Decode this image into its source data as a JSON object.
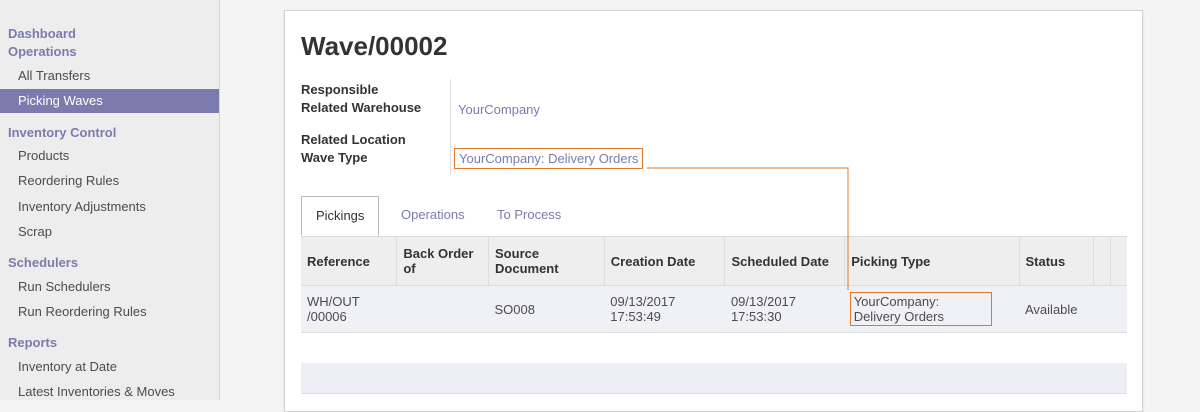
{
  "sidebar": {
    "sections": [
      {
        "title": "Dashboard",
        "items": []
      },
      {
        "title": "Operations",
        "items": [
          "All Transfers",
          "Picking Waves"
        ]
      },
      {
        "title": "Inventory Control",
        "items": [
          "Products",
          "Reordering Rules",
          "Inventory Adjustments",
          "Scrap"
        ]
      },
      {
        "title": "Schedulers",
        "items": [
          "Run Schedulers",
          "Run Reordering Rules"
        ]
      },
      {
        "title": "Reports",
        "items": [
          "Inventory at Date",
          "Latest Inventories & Moves"
        ]
      }
    ],
    "active_item": "Picking Waves"
  },
  "record": {
    "title": "Wave/00002",
    "fields": {
      "responsible_label": "Responsible",
      "related_warehouse_label": "Related Warehouse",
      "related_warehouse_value": "YourCompany",
      "related_location_label": "Related Location",
      "wave_type_label": "Wave Type",
      "wave_type_value": "YourCompany: Delivery Orders"
    }
  },
  "tabs": [
    "Pickings",
    "Operations",
    "To Process"
  ],
  "active_tab": "Pickings",
  "table": {
    "headers": [
      "Reference",
      "Back Order of",
      "Source Document",
      "Creation Date",
      "Scheduled Date",
      "Picking Type",
      "Status"
    ],
    "rows": [
      {
        "reference": "WH/OUT /00006",
        "back_order_of": "",
        "source_document": "SO008",
        "creation_date": "09/13/2017 17:53:49",
        "scheduled_date": "09/13/2017 17:53:30",
        "picking_type": "YourCompany: Delivery Orders",
        "status": "Available"
      }
    ]
  },
  "colors": {
    "accent": "#7c7bad",
    "highlight": "#e07a2a"
  }
}
